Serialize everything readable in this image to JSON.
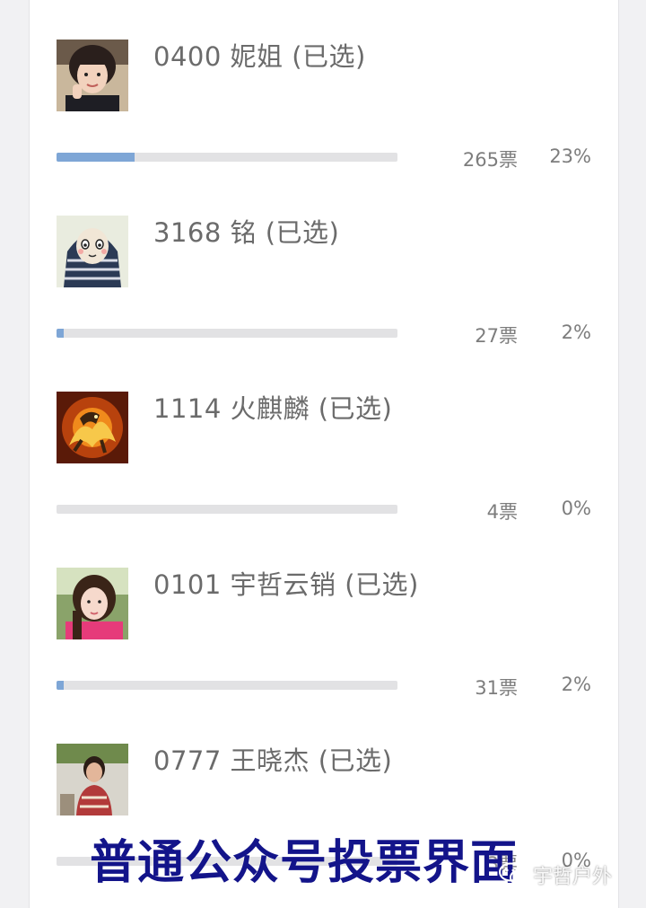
{
  "colors": {
    "bar_fill": "#7ea6d6",
    "bar_track": "#e2e2e4",
    "banner_text": "#13148a"
  },
  "options": [
    {
      "label": "0400 妮姐 (已选)",
      "votes": "265票",
      "percent": "23%",
      "share": 0.23,
      "avatar": "girl-photo-avatar"
    },
    {
      "label": "3168 铭 (已选)",
      "votes": "27票",
      "percent": "2%",
      "share": 0.02,
      "avatar": "cartoon-character-avatar"
    },
    {
      "label": "1114 火麒麟 (已选)",
      "votes": "4票",
      "percent": "0%",
      "share": 0.0,
      "avatar": "fire-qilin-avatar"
    },
    {
      "label": "0101 宇哲云销 (已选)",
      "votes": "31票",
      "percent": "2%",
      "share": 0.02,
      "avatar": "woman-photo-avatar"
    },
    {
      "label": "0777 王晓杰 (已选)",
      "votes": "3票",
      "percent": "0%",
      "share": 0.0,
      "avatar": "girl-portrait-avatar"
    }
  ],
  "overlay": {
    "banner": "普通公众号投票界面",
    "watermark": "宇哲户外",
    "watermark_icon": "wechat-icon"
  }
}
